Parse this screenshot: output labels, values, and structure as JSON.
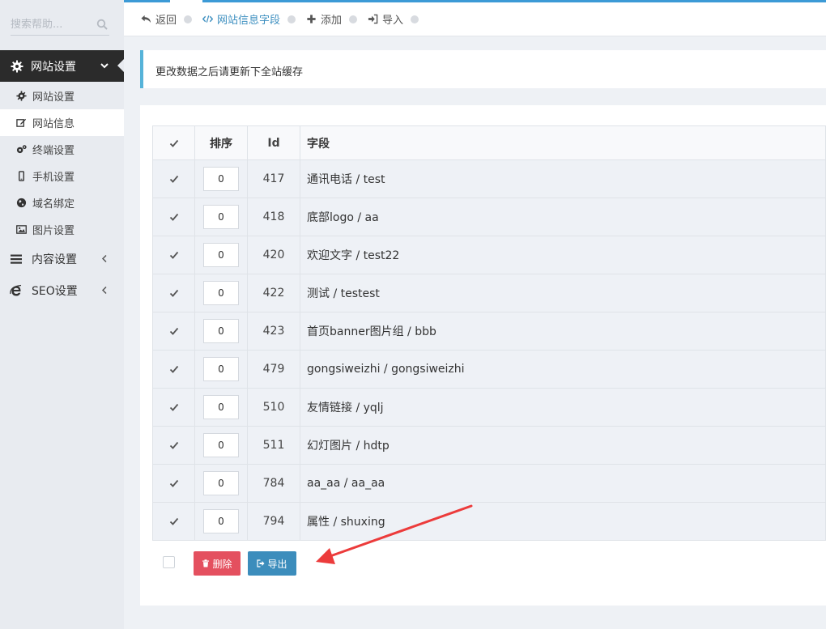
{
  "colors": {
    "accent": "#3d8fc0",
    "notice_border": "#56b3d9",
    "sidebar_active": "#2b2b2b",
    "delete": "#e4505f",
    "export": "#3c8dbc",
    "annotation_arrow": "#ec3b3b"
  },
  "sidebar": {
    "search": {
      "placeholder": "搜索帮助...",
      "icon": "search-icon"
    },
    "active_menu": {
      "label": "网站设置",
      "icon": "gear-icon"
    },
    "sub_items": [
      {
        "label": "网站设置",
        "icon": "gear-icon",
        "active": false
      },
      {
        "label": "网站信息",
        "icon": "edit-icon",
        "active": true
      },
      {
        "label": "终端设置",
        "icon": "gears-icon",
        "active": false
      },
      {
        "label": "手机设置",
        "icon": "mobile-icon",
        "active": false
      },
      {
        "label": "域名绑定",
        "icon": "globe-icon",
        "active": false
      },
      {
        "label": "图片设置",
        "icon": "image-icon",
        "active": false
      }
    ],
    "groups": [
      {
        "label": "内容设置",
        "icon": "list-icon"
      },
      {
        "label": "SEO设置",
        "icon": "ie-icon"
      }
    ]
  },
  "topbar": {
    "crumbs": [
      {
        "label": "返回",
        "icon": "reply-icon"
      },
      {
        "label": "网站信息字段",
        "icon": "code-icon",
        "current": true
      },
      {
        "label": "添加",
        "icon": "plus-icon"
      },
      {
        "label": "导入",
        "icon": "sign-in-icon"
      }
    ]
  },
  "notice": {
    "text": "更改数据之后请更新下全站缓存"
  },
  "table": {
    "headers": {
      "sort": "排序",
      "id": "Id",
      "field": "字段"
    },
    "rows": [
      {
        "sort": "0",
        "id": "417",
        "field": "通讯电话 / test"
      },
      {
        "sort": "0",
        "id": "418",
        "field": "底部logo / aa"
      },
      {
        "sort": "0",
        "id": "420",
        "field": "欢迎文字 / test22"
      },
      {
        "sort": "0",
        "id": "422",
        "field": "测试 / testest"
      },
      {
        "sort": "0",
        "id": "423",
        "field": "首页banner图片组 / bbb"
      },
      {
        "sort": "0",
        "id": "479",
        "field": "gongsiweizhi / gongsiweizhi"
      },
      {
        "sort": "0",
        "id": "510",
        "field": "友情链接 / yqlj"
      },
      {
        "sort": "0",
        "id": "511",
        "field": "幻灯图片 / hdtp"
      },
      {
        "sort": "0",
        "id": "784",
        "field": "aa_aa / aa_aa"
      },
      {
        "sort": "0",
        "id": "794",
        "field": "属性 / shuxing"
      }
    ]
  },
  "actions": {
    "delete_label": "删除",
    "delete_icon": "trash-icon",
    "export_label": "导出",
    "export_icon": "export-icon"
  }
}
